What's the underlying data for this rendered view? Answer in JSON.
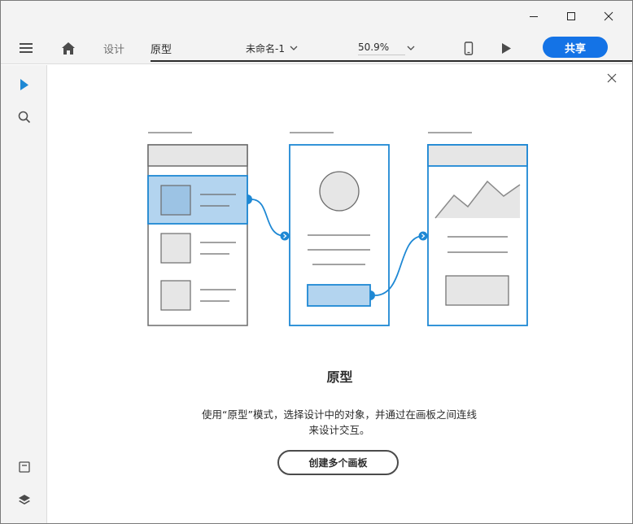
{
  "window_controls": {
    "minimize": "minimize",
    "maximize": "maximize",
    "close": "close"
  },
  "toolbar": {
    "tabs": [
      {
        "label": "设计",
        "active": false
      },
      {
        "label": "原型",
        "active": true
      }
    ],
    "document_title": "未命名-1",
    "zoom": "50.9%",
    "share_label": "共享"
  },
  "leftrail": {
    "tools": [
      "select-arrow-icon",
      "search-icon"
    ],
    "bottom": [
      "document-assets-icon",
      "layers-icon"
    ]
  },
  "main": {
    "heading": "原型",
    "description_line1": "使用“原型”模式，选择设计中的对象，并通过在画板之间连线",
    "description_line2": "来设计交互。",
    "create_button": "创建多个画板"
  },
  "colors": {
    "accent": "#1473e6",
    "wire_blue": "#1e88d4",
    "highlight": "#b3d4ef",
    "chrome": "#f3f3f3"
  }
}
